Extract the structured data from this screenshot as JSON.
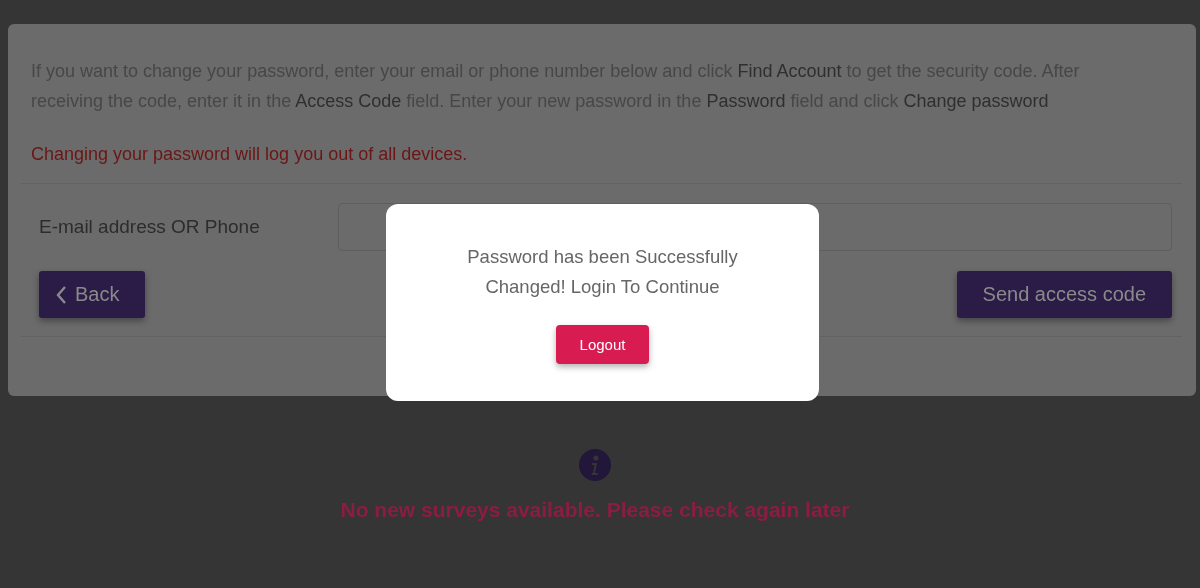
{
  "instructions": "If you want to change your password, enter your email or phone number below and click **Find Account** to get the security code. After receiving the code, enter it in the **Access Code** field. Enter your new password in the **Password** field and click **Change password**",
  "warning": "Changing your password will log you out of all devices.",
  "form": {
    "field_label": "E-mail address OR Phone",
    "back_button": "Back",
    "send_button": "Send access code"
  },
  "empty_state": {
    "message": "No new surveys available. Please check again later"
  },
  "dialog": {
    "message": "Password has been Successfully Changed! Login To Continue",
    "logout_button": "Logout"
  }
}
